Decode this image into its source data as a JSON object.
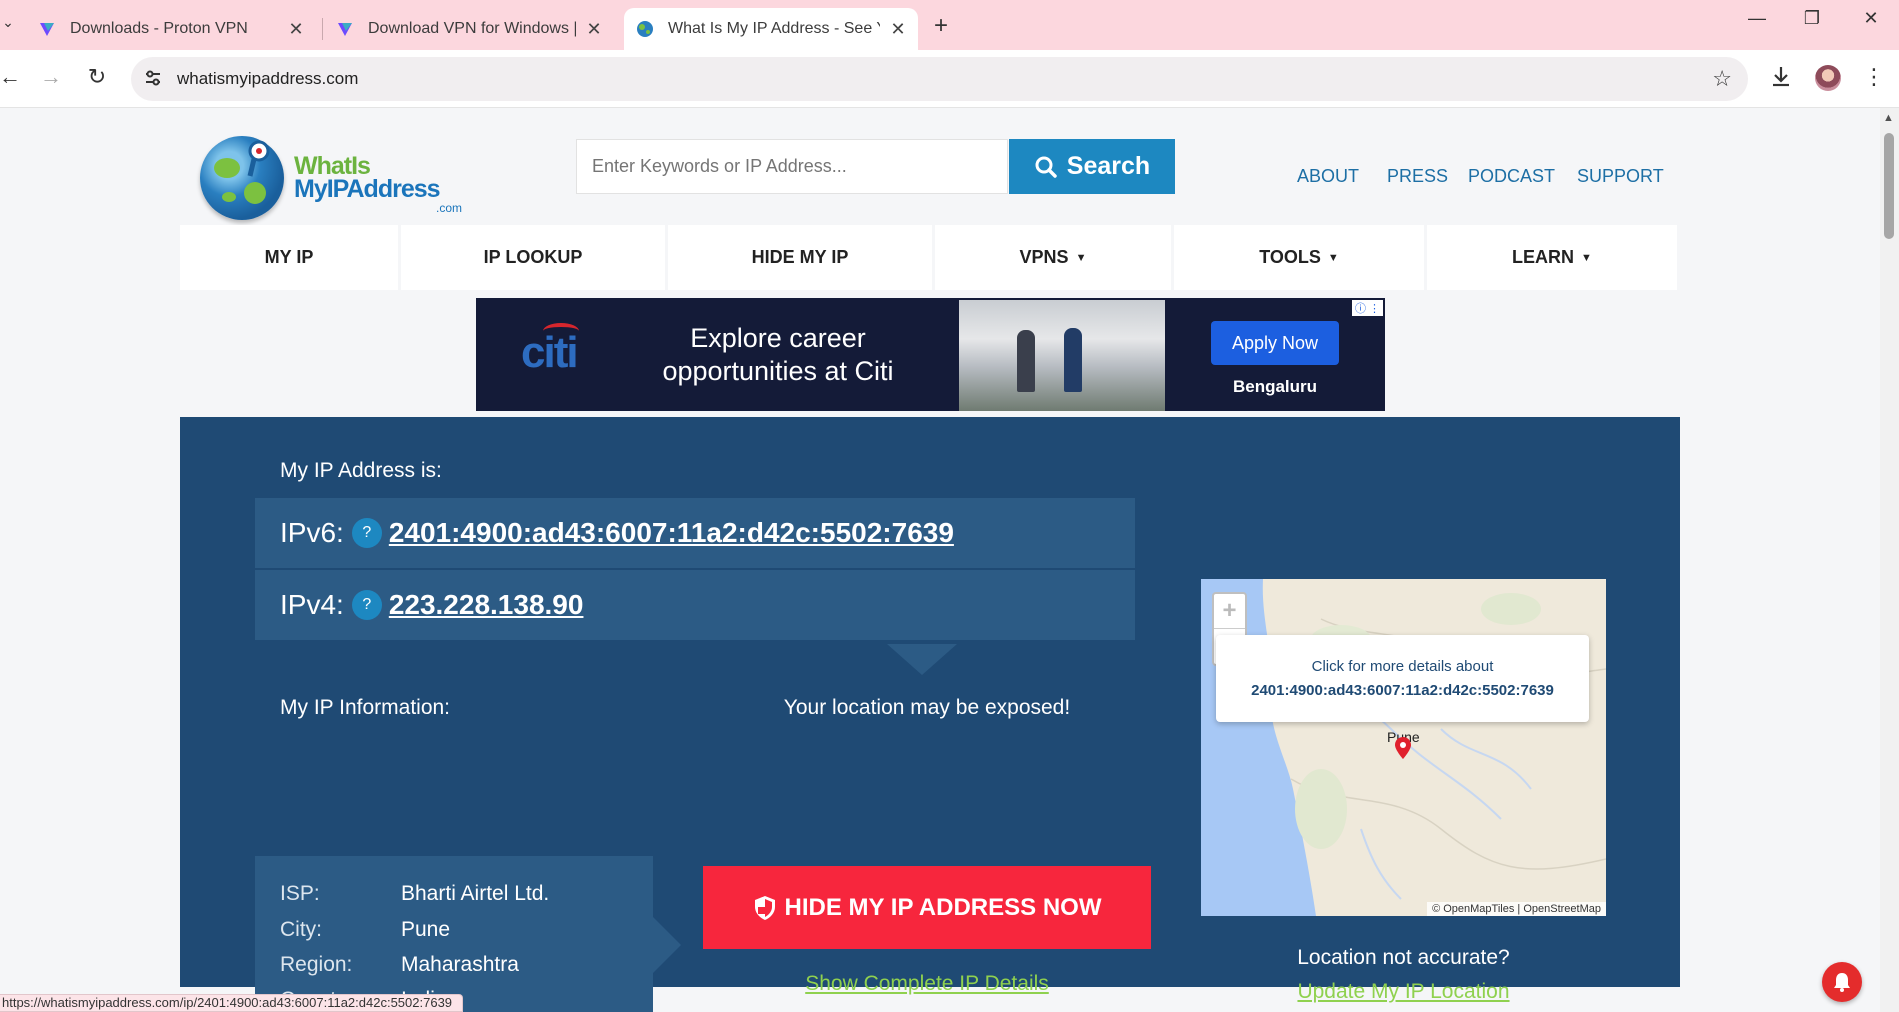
{
  "browser": {
    "tabs": [
      {
        "title": "Downloads - Proton VPN",
        "active": false
      },
      {
        "title": "Download VPN for Windows | P",
        "active": false
      },
      {
        "title": "What Is My IP Address - See Yo",
        "active": true
      }
    ],
    "new_tab_label": "+",
    "url": "whatismyipaddress.com",
    "status_url": "https://whatismyipaddress.com/ip/2401:4900:ad43:6007:11a2:d42c:5502:7639"
  },
  "site": {
    "logo": {
      "line1": "WhatIs",
      "line2": "MyIPAddress",
      "line3": ".com"
    },
    "search": {
      "placeholder": "Enter Keywords or IP Address...",
      "button_label": "Search"
    },
    "top_links": [
      "ABOUT",
      "PRESS",
      "PODCAST",
      "SUPPORT"
    ],
    "nav": [
      {
        "label": "MY IP",
        "dropdown": false
      },
      {
        "label": "IP LOOKUP",
        "dropdown": false
      },
      {
        "label": "HIDE MY IP",
        "dropdown": false
      },
      {
        "label": "VPNS",
        "dropdown": true
      },
      {
        "label": "TOOLS",
        "dropdown": true
      },
      {
        "label": "LEARN",
        "dropdown": true
      }
    ],
    "caret": "▼"
  },
  "ad": {
    "brand": "citi",
    "tagline": "Explore career opportunities at Citi",
    "cta": "Apply Now",
    "location": "Bengaluru"
  },
  "ip": {
    "heading": "My IP Address is:",
    "ipv6_label": "IPv6:",
    "ipv6": "2401:4900:ad43:6007:11a2:d42c:5502:7639",
    "ipv4_label": "IPv4:",
    "ipv4": "223.228.138.90",
    "help": "?"
  },
  "info": {
    "heading": "My IP Information:",
    "rows": [
      {
        "key": "ISP:",
        "value": "Bharti Airtel Ltd."
      },
      {
        "key": "City:",
        "value": "Pune"
      },
      {
        "key": "Region:",
        "value": "Maharashtra"
      },
      {
        "key": "Country:",
        "value": "India"
      }
    ]
  },
  "exposure": {
    "warning": "Your location may be exposed!",
    "hide_button": "HIDE MY IP ADDRESS NOW",
    "details_link": "Show Complete IP Details"
  },
  "map": {
    "zoom_in": "+",
    "zoom_out": "−",
    "popup_line1": "Click for more details about",
    "popup_line2": "2401:4900:ad43:6007:11a2:d42c:5502:7639",
    "city_label": "Pune",
    "attribution": "© OpenMapTiles | OpenStreetMap",
    "not_accurate": "Location not accurate?",
    "update_link": "Update My IP Location"
  },
  "colors": {
    "panel": "#1f4a74",
    "accent_blue": "#1d88c1",
    "hide_red": "#f7263d",
    "link_green": "#8fd14f"
  }
}
